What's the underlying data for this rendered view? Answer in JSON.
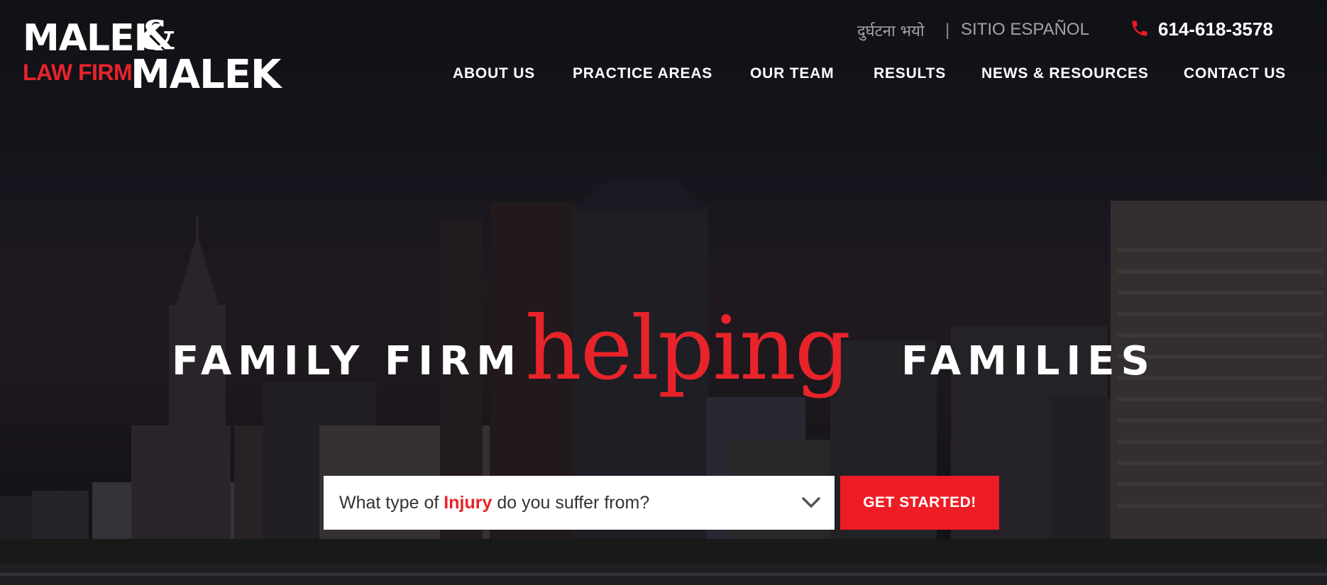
{
  "logo": {
    "line1": "MALEK",
    "ampersand": "&",
    "line2": "LAW FIRM",
    "line3": "MALEK"
  },
  "top_links": {
    "nepali": "दुर्घटना भयो",
    "separator": "|",
    "spanish": "SITIO ESPAÑOL"
  },
  "phone": {
    "icon": "phone-icon",
    "number": "614-618-3578"
  },
  "nav": {
    "items": [
      "ABOUT US",
      "PRACTICE AREAS",
      "OUR TEAM",
      "RESULTS",
      "NEWS & RESOURCES",
      "CONTACT US"
    ]
  },
  "hero": {
    "word1": "FAMILY",
    "word2": "FIRM",
    "script": "helping",
    "word3": "FAMILIES"
  },
  "search": {
    "prefix": "What type of ",
    "highlight": "Injury",
    "suffix": " do you suffer from?",
    "icon": "chevron-down-icon"
  },
  "cta": {
    "label": "GET STARTED!"
  },
  "colors": {
    "accent": "#ee1c25",
    "text": "#ffffff",
    "muted": "#a3a3a8"
  }
}
